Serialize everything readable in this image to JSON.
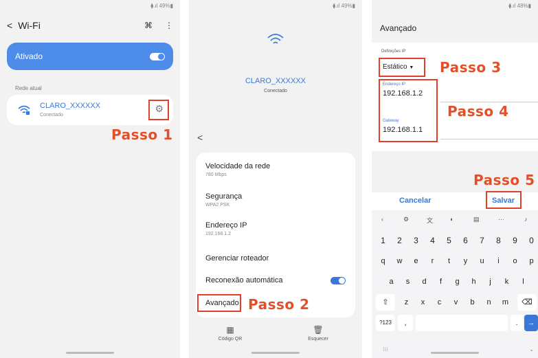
{
  "phone1": {
    "status": "⧫.ıl 49%▮",
    "back_icon": "chevron-left-icon",
    "title": "Wi-Fi",
    "ativado_label": "Ativado",
    "rede_atual_label": "Rede atual",
    "network_name": "CLARO_XXXXXX",
    "network_status": "Conectado",
    "step_label": "Passo 1",
    "accent": "#4d8ce8"
  },
  "phone2": {
    "status": "⧫.ıl 49%▮",
    "network_name": "CLARO_XXXXXX",
    "network_status": "Conectado",
    "items": [
      {
        "title": "Velocidade da rede",
        "sub": "780 Mbps"
      },
      {
        "title": "Segurança",
        "sub": "WPA2 PSK"
      },
      {
        "title": "Endereço IP",
        "sub": "192.168.1.2"
      },
      {
        "title": "Gerenciar roteador",
        "sub": ""
      },
      {
        "title": "Reconexão automática",
        "sub": ""
      },
      {
        "title": "Avançado",
        "sub": ""
      }
    ],
    "step_label": "Passo 2",
    "qr_label": "Código QR",
    "forget_label": "Esquecer"
  },
  "phone3": {
    "status": "⧫.ıl 48%▮",
    "title": "Avançado",
    "ip_settings_label": "Definições IP",
    "ip_mode": "Estático",
    "ip_address_label": "Endereço IP",
    "ip_address": "192.168.1.2",
    "gateway_label": "Gateway",
    "gateway": "192.168.1.1",
    "step3_label": "Passo 3",
    "step4_label": "Passo 4",
    "step5_label": "Passo 5",
    "cancel_label": "Cancelar",
    "save_label": "Salvar",
    "keyboard": {
      "numbers": [
        "1",
        "2",
        "3",
        "4",
        "5",
        "6",
        "7",
        "8",
        "9",
        "0"
      ],
      "row1": [
        "q",
        "w",
        "e",
        "r",
        "t",
        "y",
        "u",
        "i",
        "o",
        "p"
      ],
      "row2": [
        "a",
        "s",
        "d",
        "f",
        "g",
        "h",
        "j",
        "k",
        "l"
      ],
      "row3": [
        "z",
        "x",
        "c",
        "v",
        "b",
        "n",
        "m"
      ],
      "symbols_key": "?123",
      "comma_key": ",",
      "period_key": ".",
      "ellipsis": "···"
    }
  }
}
